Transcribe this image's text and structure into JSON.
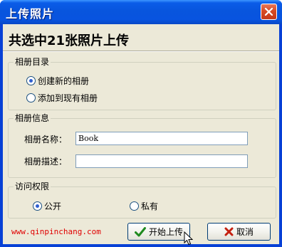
{
  "window": {
    "title": "上传照片",
    "close_icon": "close-icon"
  },
  "header": {
    "text": "共选中21张照片上传"
  },
  "album_dir": {
    "title": "相册目录",
    "options": [
      {
        "label": "创建新的相册",
        "checked": true
      },
      {
        "label": "添加到现有相册",
        "checked": false
      }
    ]
  },
  "album_info": {
    "title": "相册信息",
    "name_label": "相册名称：",
    "name_value": "Book",
    "desc_label": "相册描述：",
    "desc_value": ""
  },
  "access": {
    "title": "访问权限",
    "options": [
      {
        "label": "公开",
        "checked": true
      },
      {
        "label": "私有",
        "checked": false
      }
    ]
  },
  "footer": {
    "link": "www.qinpinchang.com",
    "upload_label": "开始上传",
    "upload_icon": "checkmark-icon",
    "cancel_label": "取消",
    "cancel_icon": "x-icon"
  },
  "colors": {
    "titlebar": "#0855dd",
    "client": "#ece9d8",
    "link": "#e00000",
    "close": "#d84a22"
  }
}
